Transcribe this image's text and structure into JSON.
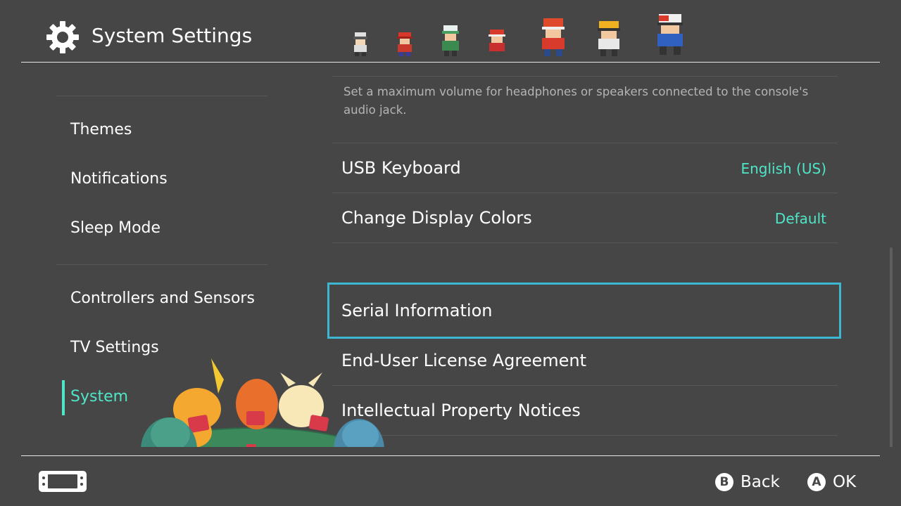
{
  "header": {
    "title": "System Settings",
    "icon": "gear-icon"
  },
  "sidebar": {
    "items": [
      {
        "label": "Themes"
      },
      {
        "label": "Notifications"
      },
      {
        "label": "Sleep Mode"
      },
      {
        "label": "Controllers and Sensors"
      },
      {
        "label": "TV Settings"
      },
      {
        "label": "System",
        "active": true
      }
    ]
  },
  "main": {
    "description": "Set a maximum volume for headphones or speakers connected to the console's audio jack.",
    "rows": [
      {
        "label": "USB Keyboard",
        "value": "English (US)"
      },
      {
        "label": "Change Display Colors",
        "value": "Default"
      },
      {
        "label": "Serial Information",
        "value": "",
        "selected": true
      },
      {
        "label": "End-User License Agreement",
        "value": ""
      },
      {
        "label": "Intellectual Property Notices",
        "value": ""
      }
    ]
  },
  "footer": {
    "console_icon": "switch-console-icon",
    "buttons": [
      {
        "key": "B",
        "label": "Back"
      },
      {
        "key": "A",
        "label": "OK"
      }
    ]
  },
  "colors": {
    "background": "#464646",
    "accent": "#4ee6c7",
    "focus_border": "#3cb7d2",
    "description_text": "#b4b4b4"
  }
}
